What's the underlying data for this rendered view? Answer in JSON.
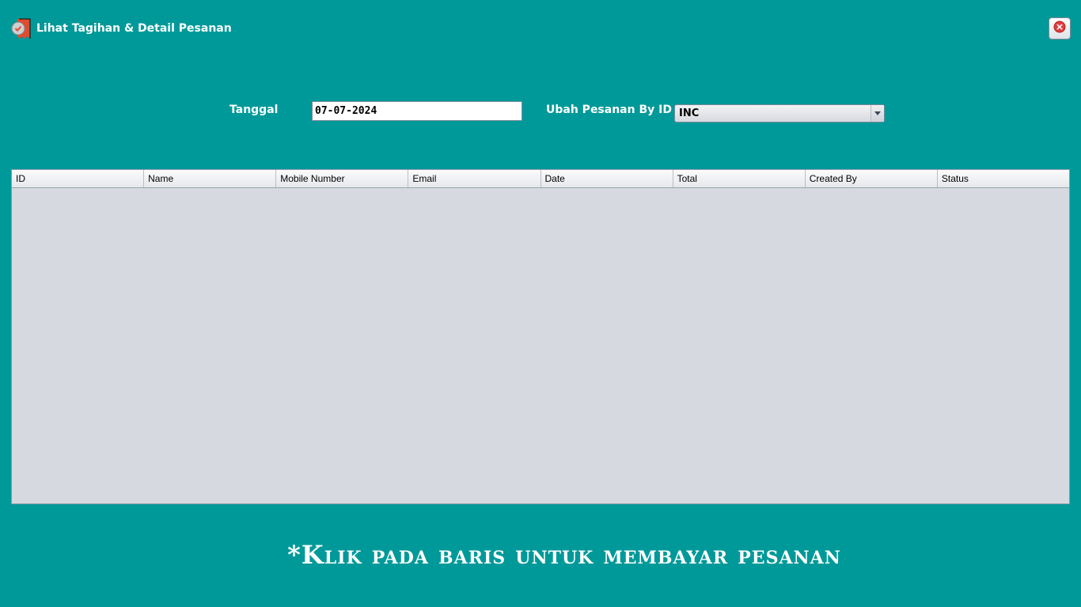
{
  "window": {
    "title": "Lihat Tagihan & Detail Pesanan",
    "title_icon": "bill-check-icon",
    "close_icon": "close-icon"
  },
  "form": {
    "date_label": "Tanggal",
    "date_value": "07-07-2024",
    "order_id_label": "Ubah Pesanan By ID",
    "order_id_selected": "INC"
  },
  "table": {
    "columns": [
      "ID",
      "Name",
      "Mobile Number",
      "Email",
      "Date",
      "Total",
      "Created By",
      "Status"
    ],
    "rows": []
  },
  "footer": {
    "note": "*Klik pada baris untuk membayar pesanan"
  },
  "colors": {
    "background": "#009999",
    "table_background": "#d6d9e0",
    "close_red": "#e03c3c"
  }
}
